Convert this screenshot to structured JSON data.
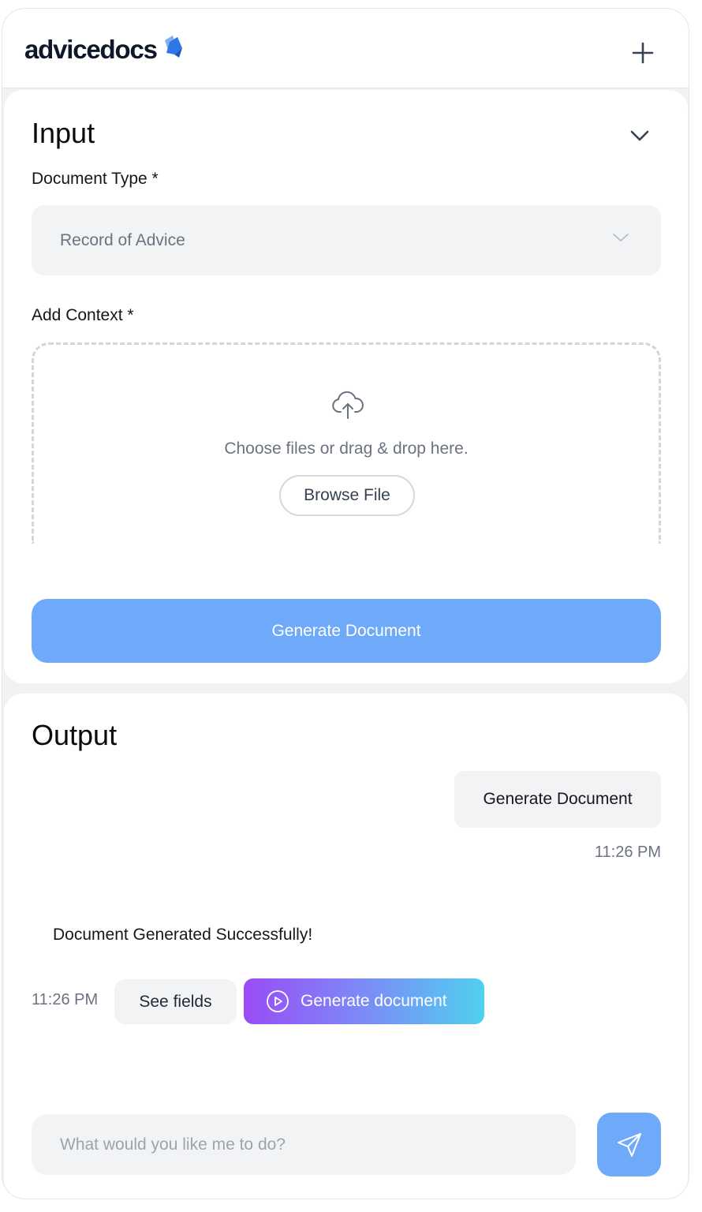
{
  "header": {
    "logo_text": "advicedocs",
    "logo_icon": "blue-diamond-logo-mark",
    "new_icon": "plus-icon"
  },
  "input": {
    "title": "Input",
    "collapse_icon": "chevron-down-icon",
    "document_type_label": "Document Type *",
    "document_type_value": "Record of Advice",
    "add_context_label": "Add Context *",
    "upload_icon": "cloud-upload-icon",
    "drop_text": "Choose files or drag & drop here.",
    "browse_label": "Browse File",
    "generate_label": "Generate Document"
  },
  "output": {
    "title": "Output",
    "messages": [
      {
        "role": "user",
        "text": "Generate Document",
        "time": "11:26 PM"
      },
      {
        "role": "assistant",
        "text": "Document Generated Successfully!",
        "time": "11:26 PM"
      }
    ],
    "see_fields_label": "See fields",
    "generate_document_label": "Generate document",
    "play_icon": "play-circle-icon"
  },
  "composer": {
    "placeholder": "What would you like me to do?",
    "send_icon": "send-icon"
  },
  "colors": {
    "primary": "#6eaaf9",
    "gradient_start": "#9a4cf6",
    "gradient_end": "#4fd0ee",
    "surface": "#f2f3f5"
  }
}
